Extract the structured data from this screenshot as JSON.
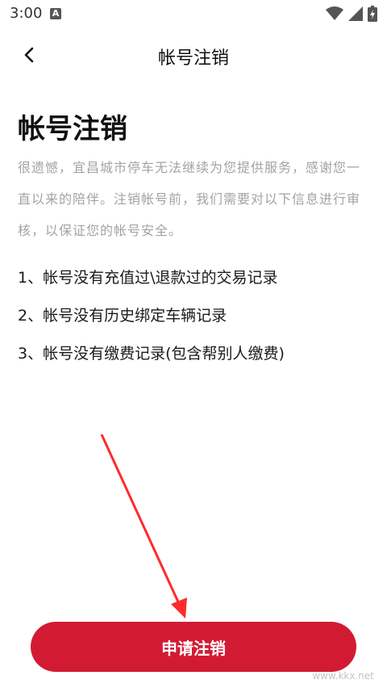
{
  "status_bar": {
    "time": "3:00",
    "notification_icon": "A"
  },
  "nav": {
    "title": "帐号注销"
  },
  "page": {
    "heading": "帐号注销",
    "intro": "很遗憾，宜昌城市停车无法继续为您提供服务，感谢您一直以来的陪伴。注销帐号前，我们需要对以下信息进行审核，以保证您的帐号安全。",
    "items": [
      "1、帐号没有充值过\\退款过的交易记录",
      "2、帐号没有历史绑定车辆记录",
      "3、帐号没有缴费记录(包含帮别人缴费)"
    ]
  },
  "button": {
    "label": "申请注销"
  },
  "watermark": "www.kkx.net",
  "colors": {
    "accent": "#d21b33",
    "annotation_arrow": "#ff2a2a"
  }
}
